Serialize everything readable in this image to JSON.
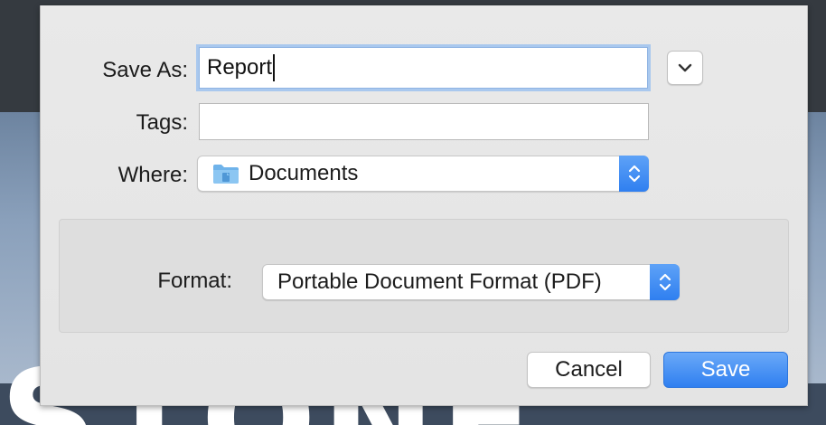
{
  "dialog": {
    "save_as_label": "Save As:",
    "save_as_value": "Report",
    "tags_label": "Tags:",
    "tags_value": "",
    "where_label": "Where:",
    "where_value": "Documents",
    "format_label": "Format:",
    "format_value": "Portable Document Format (PDF)",
    "cancel_label": "Cancel",
    "save_label": "Save"
  },
  "background": {
    "letters": "STONE"
  },
  "colors": {
    "accent": "#2f7ff0",
    "focus_ring": "#a9c8ee",
    "folder_icon": "#6fb3ea"
  },
  "icons": {
    "disclosure": "chevron-down-icon",
    "where_folder": "folder-icon",
    "stepper": "up-down-chevron-icon"
  }
}
